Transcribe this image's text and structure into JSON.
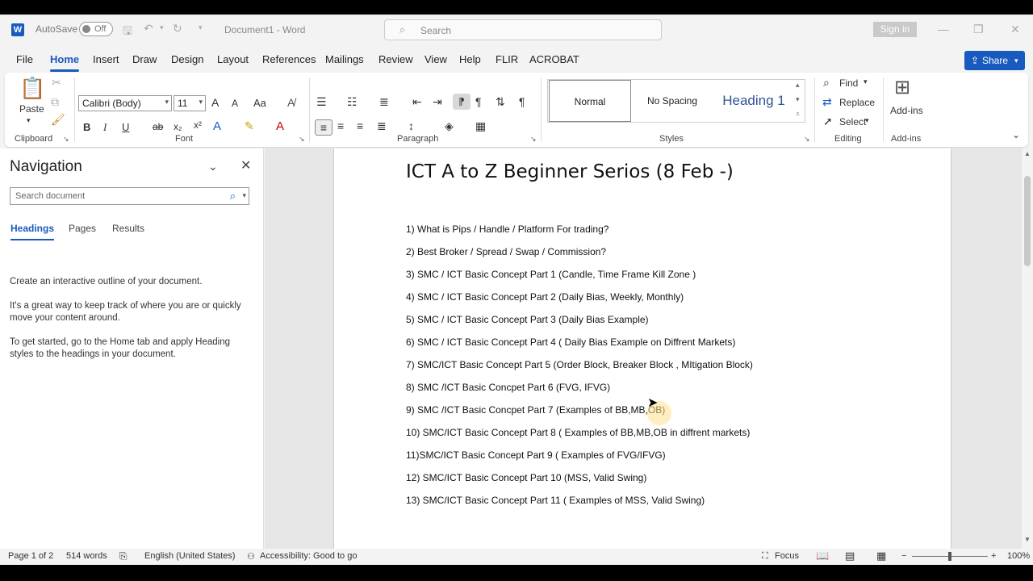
{
  "titlebar": {
    "autosave_label": "AutoSave",
    "autosave_state": "Off",
    "doc_title": "Document1  -  Word",
    "search_placeholder": "Search",
    "signin_label": "Sign in",
    "minimize": "—",
    "restore": "❐",
    "close": "✕"
  },
  "tabs": [
    "File",
    "Home",
    "Insert",
    "Draw",
    "Design",
    "Layout",
    "References",
    "Mailings",
    "Review",
    "View",
    "Help",
    "FLIR",
    "ACROBAT"
  ],
  "active_tab": "Home",
  "share_label": "Share",
  "ribbon": {
    "clipboard": {
      "paste_label": "Paste",
      "group_label": "Clipboard"
    },
    "font": {
      "font_name": "Calibri (Body)",
      "font_size": "11",
      "group_label": "Font",
      "grow": "A",
      "shrink": "A",
      "case": "Aa"
    },
    "paragraph": {
      "group_label": "Paragraph"
    },
    "styles": {
      "group_label": "Styles",
      "items": [
        "Normal",
        "No Spacing",
        "Heading 1"
      ]
    },
    "editing": {
      "group_label": "Editing",
      "find": "Find",
      "replace": "Replace",
      "select": "Select"
    },
    "addins": {
      "label": "Add-ins",
      "group_label": "Add-ins"
    }
  },
  "navigation": {
    "title": "Navigation",
    "search_placeholder": "Search document",
    "tabs": [
      "Headings",
      "Pages",
      "Results"
    ],
    "active_tab": "Headings",
    "help_text_1": "Create an interactive outline of your document.",
    "help_text_2": "It's a great way to keep track of where you are or quickly move your content around.",
    "help_text_3": "To get started, go to the Home tab and apply Heading styles to the headings in your document."
  },
  "document": {
    "heading": "ICT A to Z Beginner Serios (8 Feb -)",
    "lines": [
      "1) What is Pips / Handle / Platform For trading?",
      "2) Best Broker / Spread / Swap / Commission?",
      "3) SMC / ICT Basic Concept Part 1 (Candle, Time Frame Kill Zone )",
      "4) SMC / ICT Basic Concept Part 2 (Daily Bias, Weekly, Monthly)",
      "5) SMC / ICT Basic Concept Part 3 (Daily Bias Example)",
      "6) SMC / ICT Basic Concept Part 4 ( Daily Bias Example on Diffrent Markets)",
      "7) SMC/ICT Basic Concept Part 5 (Order Block, Breaker Block , MItigation Block)",
      "8) SMC /ICT Basic Concpet Part 6 (FVG, IFVG)",
      "9) SMC /ICT Basic Concpet Part 7 (Examples of BB,MB,OB)",
      "10) SMC/ICT Basic Concept Part 8 ( Examples of BB,MB,OB in diffrent markets)",
      "11)SMC/ICT Basic Concept Part 9 ( Examples of FVG/IFVG)",
      "12) SMC/ICT Basic Concept Part 10 (MSS, Valid Swing)",
      "13) SMC/ICT Basic Concept Part 11 ( Examples of MSS, Valid Swing)"
    ]
  },
  "statusbar": {
    "page": "Page 1 of 2",
    "words": "514 words",
    "language": "English (United States)",
    "accessibility": "Accessibility: Good to go",
    "focus": "Focus",
    "zoom_level": "100%",
    "zoom_minus": "−",
    "zoom_plus": "+"
  },
  "colors": {
    "accent": "#185abd",
    "heading1": "#2f5496",
    "spell_error": "#d33"
  }
}
